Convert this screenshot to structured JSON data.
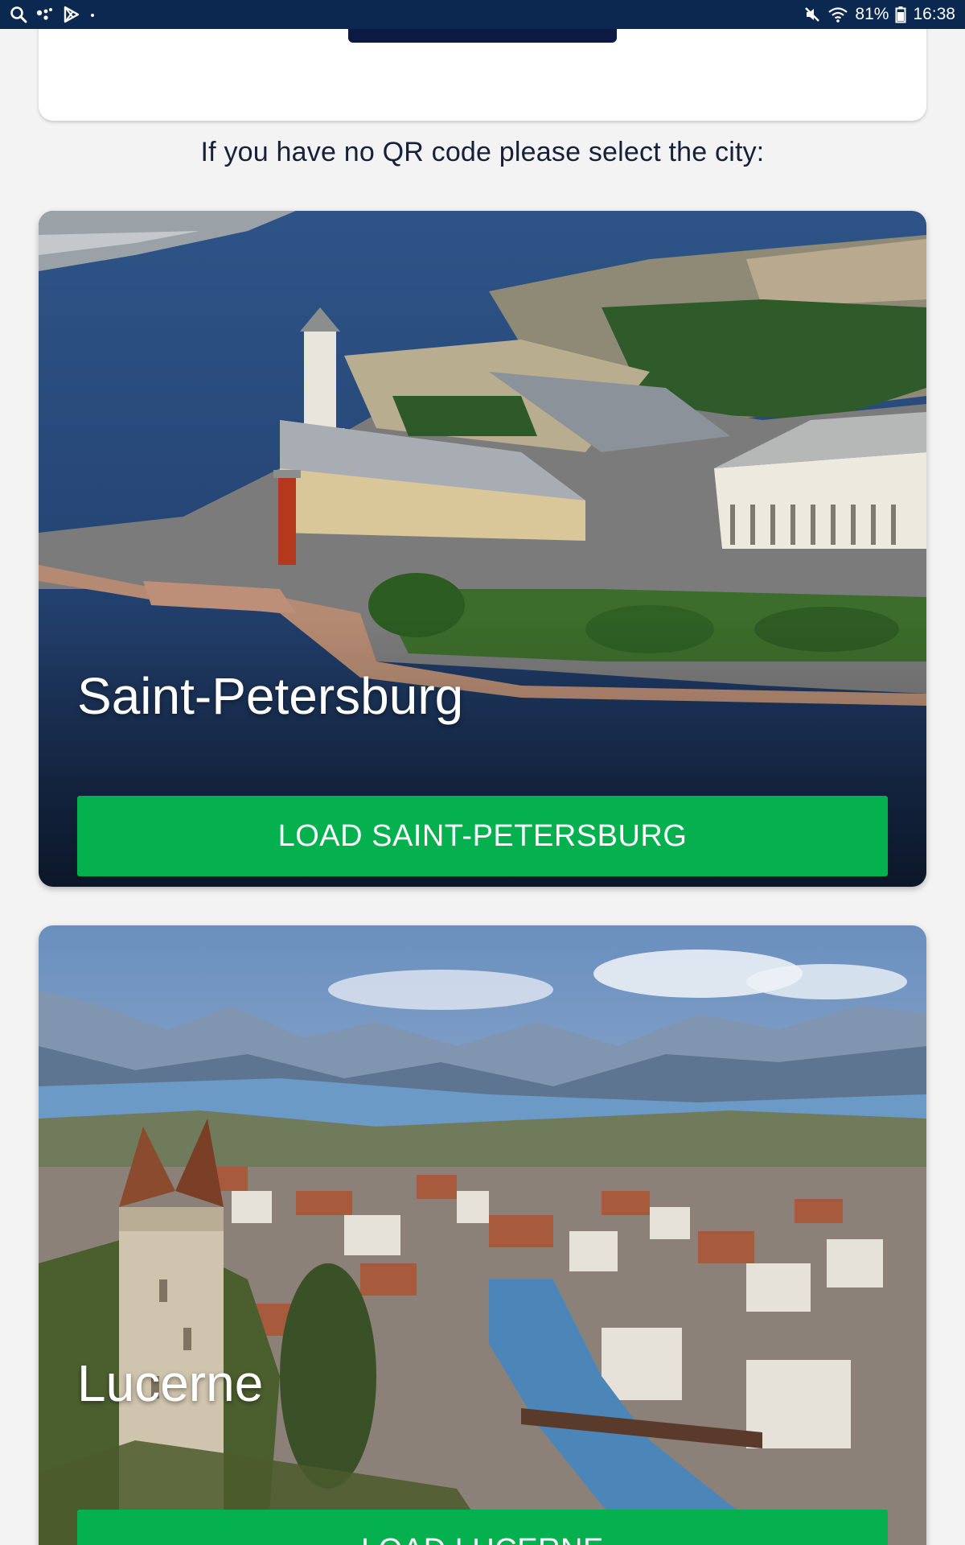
{
  "status_bar": {
    "left_icons": [
      "search-icon",
      "assistant-icon",
      "play-store-icon",
      "dot-icon"
    ],
    "right_icons": [
      "mute-icon",
      "wifi-icon",
      "battery-icon"
    ],
    "battery": "81%",
    "time": "16:38"
  },
  "prompt": "If you have no QR code please select the city:",
  "cities": [
    {
      "name": "Saint-Petersburg",
      "button": "LOAD SAINT-PETERSBURG",
      "photo": "spb-aerial-photo"
    },
    {
      "name": "Lucerne",
      "button": "LOAD LUCERNE",
      "photo": "lucerne-aerial-photo"
    }
  ],
  "colors": {
    "status_bar": "#0b2850",
    "background": "#f3f3f3",
    "load_button": "#05b04f",
    "qr_button": "#0d1b44",
    "prompt_text": "#16203a"
  }
}
